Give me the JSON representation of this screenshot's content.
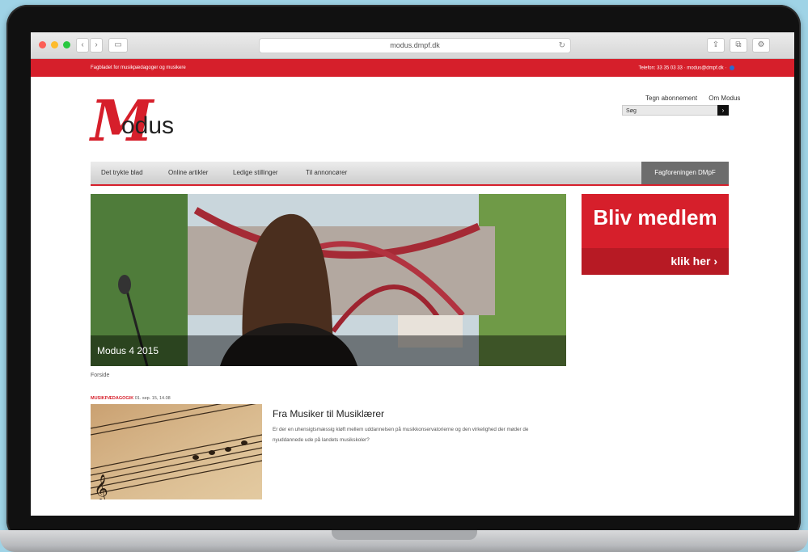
{
  "browser": {
    "url": "modus.dmpf.dk",
    "reload_icon": "reload-icon"
  },
  "topstrip": {
    "tagline": "Fagbladet for musikpædagoger og musikere",
    "contact": "Telefon: 33 35 03 33 · modus@dmpf.dk ·"
  },
  "header": {
    "logo_m": "M",
    "logo_rest": "odus",
    "links": [
      "Tegn abonnement",
      "Om Modus"
    ],
    "search_placeholder": "Søg",
    "search_button": "›"
  },
  "nav": {
    "items": [
      "Det trykte blad",
      "Online artikler",
      "Ledige stillinger",
      "Til annoncører"
    ],
    "member": "Fagforeningen DMpF"
  },
  "hero": {
    "caption": "Modus 4 2015"
  },
  "join": {
    "title": "Bliv medlem",
    "sub": "klik her ›"
  },
  "breadcrumb": "Forside",
  "article": {
    "category": "MUSIKPÆDAGOGIK",
    "date": "01. sep. 15, 14.08",
    "title": "Fra Musiker til Musiklærer",
    "text": "Er der en uhensigtsmæssig kløft mellem uddannelsen på musikkonservatorierne og den virkelighed der møder de nyuddannede ude på landets musikskoler?"
  },
  "colors": {
    "brand_red": "#d61f2b",
    "nav_dark": "#6d6d6d"
  }
}
